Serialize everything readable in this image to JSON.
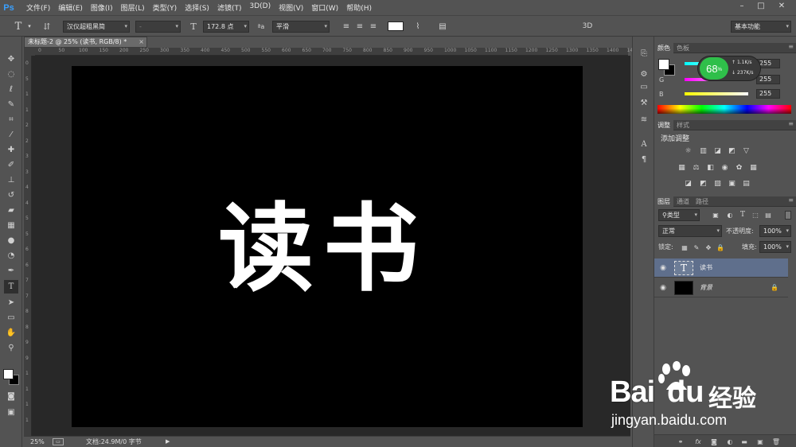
{
  "app": {
    "logo": "Ps"
  },
  "menu": [
    "文件(F)",
    "编辑(E)",
    "图像(I)",
    "图层(L)",
    "类型(Y)",
    "选择(S)",
    "滤镜(T)",
    "3D(D)",
    "视图(V)",
    "窗口(W)",
    "帮助(H)"
  ],
  "window_controls": {
    "minimize": "–",
    "restore": "□",
    "close": "✕"
  },
  "options": {
    "font_family": "汉仪超粗黑简",
    "font_style": "-",
    "font_size": "172.8 点",
    "aa_label": "ªa",
    "antialias": "平滑",
    "label_3d": "3D",
    "workspace": "基本功能"
  },
  "document": {
    "tab_title": "未标题-2 @ 25% (读书, RGB/8) *",
    "canvas_text": "读书",
    "canvas_bg": "#000000",
    "text_color": "#ffffff"
  },
  "ruler": {
    "top_ticks": [
      "0",
      "50",
      "100",
      "150",
      "200",
      "250",
      "300",
      "350",
      "400",
      "450",
      "500",
      "550",
      "600",
      "650",
      "700",
      "750",
      "800",
      "850",
      "900",
      "950",
      "1000",
      "1050",
      "1100",
      "1150",
      "1200",
      "1250",
      "1300",
      "1350",
      "1400",
      "1450"
    ],
    "left_ticks": [
      "0",
      "5",
      "1",
      "1",
      "2",
      "2",
      "3",
      "3",
      "4",
      "4",
      "5",
      "5",
      "6",
      "6",
      "7",
      "7",
      "8",
      "8",
      "9",
      "9",
      "1",
      "1",
      "1",
      "1"
    ]
  },
  "status": {
    "zoom": "25%",
    "doc_info": "文档:24.9M/0 字节"
  },
  "color_panel": {
    "tabs": [
      "颜色",
      "色板"
    ],
    "r": {
      "label": "R",
      "value": "255"
    },
    "g": {
      "label": "G",
      "value": "255"
    },
    "b": {
      "label": "B",
      "value": "255"
    }
  },
  "perf_widget": {
    "percent": "68",
    "unit": "%",
    "up": "1.1K/s",
    "down": "237K/s"
  },
  "adjust_panel": {
    "tabs": [
      "调整",
      "样式"
    ],
    "title": "添加调整"
  },
  "layers_panel": {
    "tabs": [
      "图层",
      "通道",
      "路径"
    ],
    "filter": "类型",
    "blend_mode": "正常",
    "opacity_label": "不透明度:",
    "opacity": "100%",
    "lock_label": "锁定:",
    "fill_label": "填充:",
    "fill": "100%",
    "layers": [
      {
        "name": "读书",
        "type": "text",
        "thumb": "T",
        "selected": true
      },
      {
        "name": "背景",
        "type": "background",
        "thumb": "",
        "selected": false,
        "locked": true
      }
    ]
  },
  "watermark": {
    "bai": "Bai",
    "du": "du",
    "jingyan": "经验",
    "url": "jingyan.baidu.com"
  }
}
